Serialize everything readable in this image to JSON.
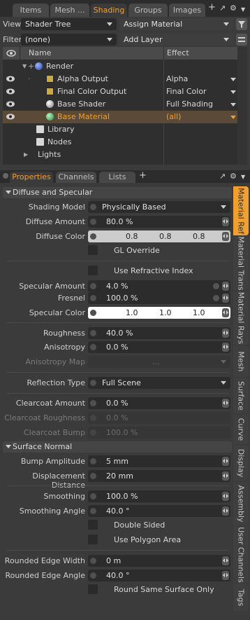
{
  "top_tabs": [
    "Items",
    "Mesh ...",
    "Shading",
    "Groups",
    "Images"
  ],
  "top_tab_add": "+",
  "view": {
    "label": "View",
    "value": "Shader Tree",
    "assign_button": "Assign Material"
  },
  "filter": {
    "label": "Filter",
    "value": "(none)",
    "add_layer": "Add Layer"
  },
  "tree": {
    "col_name": "Name",
    "col_effect": "Effect",
    "rows": [
      {
        "name": "Render",
        "effect": ""
      },
      {
        "name": "Alpha Output",
        "effect": "Alpha"
      },
      {
        "name": "Final Color Output",
        "effect": "Final Color"
      },
      {
        "name": "Base Shader",
        "effect": "Full Shading"
      },
      {
        "name": "Base Material",
        "effect": "(all)"
      },
      {
        "name": "Library",
        "effect": ""
      },
      {
        "name": "Nodes",
        "effect": ""
      },
      {
        "name": "Lights",
        "effect": ""
      }
    ]
  },
  "bottom_tabs": [
    "Properties",
    "Channels",
    "Lists"
  ],
  "bottom_tab_add": "+",
  "props": {
    "diffuse_section": "Diffuse and Specular",
    "shading_model": {
      "label": "Shading Model",
      "value": "Physically Based"
    },
    "diffuse_amount": {
      "label": "Diffuse Amount",
      "value": "80.0 %"
    },
    "diffuse_color": {
      "label": "Diffuse Color",
      "r": "0.8",
      "g": "0.8",
      "b": "0.8"
    },
    "gl_override": "GL Override",
    "use_refractive": "Use Refractive Index",
    "specular_amount": {
      "label": "Specular Amount",
      "value": "4.0 %"
    },
    "fresnel": {
      "label": "Fresnel",
      "value": "100.0 %"
    },
    "specular_color": {
      "label": "Specular Color",
      "r": "1.0",
      "g": "1.0",
      "b": "1.0"
    },
    "roughness": {
      "label": "Roughness",
      "value": "40.0 %"
    },
    "anisotropy": {
      "label": "Anisotropy",
      "value": "0.0 %"
    },
    "anisotropy_map": {
      "label": "Anisotropy Map",
      "value": "..."
    },
    "reflection_type": {
      "label": "Reflection Type",
      "value": "Full Scene"
    },
    "clearcoat_amount": {
      "label": "Clearcoat Amount",
      "value": "0.0 %"
    },
    "clearcoat_roughness": {
      "label": "Clearcoat Roughness",
      "value": "0.0 %"
    },
    "clearcoat_bump": {
      "label": "Clearcoat Bump",
      "value": "100.0 %"
    },
    "surface_section": "Surface Normal",
    "bump_amplitude": {
      "label": "Bump Amplitude",
      "value": "5 mm"
    },
    "displacement_distance": {
      "label": "Displacement Distance",
      "value": "20 mm"
    },
    "smoothing": {
      "label": "Smoothing",
      "value": "100.0 %"
    },
    "smoothing_angle": {
      "label": "Smoothing Angle",
      "value": "40.0 °"
    },
    "double_sided": "Double Sided",
    "use_polygon_area": "Use Polygon Area",
    "rounded_edge_width": {
      "label": "Rounded Edge Width",
      "value": "0 m"
    },
    "rounded_edge_angle": {
      "label": "Rounded Edge Angle",
      "value": "40.0 °"
    },
    "round_same_surface": "Round Same Surface Only"
  },
  "side_tabs": [
    "Material Ref",
    "Material Trans",
    "Material Rays",
    "Mesh",
    "Surface",
    "Curve",
    "Display",
    "Assembly",
    "User Channels",
    "Tags"
  ],
  "colors": {
    "accent": "#f0a030",
    "selected_row": "#5a4a37",
    "panel": "#3b3b3b",
    "field": "#2c2c2c"
  }
}
